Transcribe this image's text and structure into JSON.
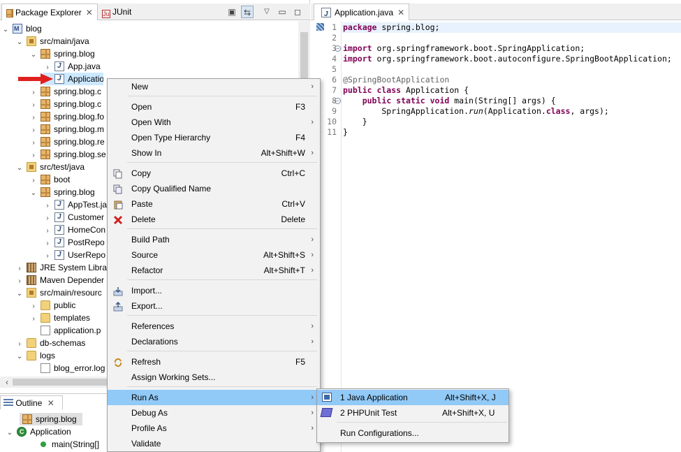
{
  "package_explorer": {
    "tab_label": "Package Explorer",
    "junit_tab_label": "JUnit",
    "close_glyph": "✕"
  },
  "tree": [
    {
      "label": "blog",
      "twisty": "⌄",
      "icon": "project-icon"
    },
    {
      "label": "src/main/java",
      "twisty": "⌄",
      "icon": "source-folder-icon"
    },
    {
      "label": "spring.blog",
      "twisty": "⌄",
      "icon": "package-icon"
    },
    {
      "label": "App.java",
      "twisty": "›",
      "icon": "java-file-icon"
    },
    {
      "label": "Application.java",
      "twisty": "›",
      "icon": "java-file-icon"
    },
    {
      "label": "spring.blog.c",
      "twisty": "›",
      "icon": "package-icon"
    },
    {
      "label": "spring.blog.c",
      "twisty": "›",
      "icon": "package-icon"
    },
    {
      "label": "spring.blog.fo",
      "twisty": "›",
      "icon": "package-icon"
    },
    {
      "label": "spring.blog.m",
      "twisty": "›",
      "icon": "package-icon"
    },
    {
      "label": "spring.blog.re",
      "twisty": "›",
      "icon": "package-icon"
    },
    {
      "label": "spring.blog.se",
      "twisty": "›",
      "icon": "package-icon"
    },
    {
      "label": "src/test/java",
      "twisty": "⌄",
      "icon": "source-folder-icon"
    },
    {
      "label": "boot",
      "twisty": "›",
      "icon": "package-icon"
    },
    {
      "label": "spring.blog",
      "twisty": "⌄",
      "icon": "package-icon"
    },
    {
      "label": "AppTest.ja",
      "twisty": "›",
      "icon": "java-file-icon"
    },
    {
      "label": "Customer",
      "twisty": "›",
      "icon": "java-file-icon"
    },
    {
      "label": "HomeCon",
      "twisty": "›",
      "icon": "java-file-icon"
    },
    {
      "label": "PostRepo",
      "twisty": "›",
      "icon": "java-file-icon"
    },
    {
      "label": "UserRepo",
      "twisty": "›",
      "icon": "java-file-icon"
    },
    {
      "label": "JRE System Librar",
      "twisty": "›",
      "icon": "library-icon"
    },
    {
      "label": "Maven Depender",
      "twisty": "›",
      "icon": "library-icon"
    },
    {
      "label": "src/main/resourc",
      "twisty": "⌄",
      "icon": "source-folder-icon"
    },
    {
      "label": "public",
      "twisty": "›",
      "icon": "folder-icon"
    },
    {
      "label": "templates",
      "twisty": "›",
      "icon": "folder-icon"
    },
    {
      "label": "application.p",
      "twisty": "",
      "icon": "file-icon"
    },
    {
      "label": "db-schemas",
      "twisty": "›",
      "icon": "folder-icon"
    },
    {
      "label": "logs",
      "twisty": "⌄",
      "icon": "folder-icon"
    },
    {
      "label": "blog_error.log",
      "twisty": "",
      "icon": "file-icon"
    }
  ],
  "outline": {
    "tab_label": "Outline",
    "items": [
      {
        "label": "spring.blog"
      },
      {
        "label": "Application"
      },
      {
        "label": "main(String[]"
      }
    ]
  },
  "editor": {
    "tab_label": "Application.java",
    "lines": [
      {
        "n": "1",
        "parts": [
          {
            "t": "package",
            "c": "kw"
          },
          {
            "t": " spring.blog;",
            "c": ""
          }
        ]
      },
      {
        "n": "2",
        "parts": []
      },
      {
        "n": "3",
        "parts": [
          {
            "t": "import",
            "c": "kw"
          },
          {
            "t": " org.springframework.boot.SpringApplication;",
            "c": ""
          }
        ]
      },
      {
        "n": "4",
        "parts": [
          {
            "t": "import",
            "c": "kw"
          },
          {
            "t": " org.springframework.boot.autoconfigure.SpringBootApplication;",
            "c": ""
          }
        ]
      },
      {
        "n": "5",
        "parts": []
      },
      {
        "n": "6",
        "parts": [
          {
            "t": "@SpringBootApplication",
            "c": "ann"
          }
        ]
      },
      {
        "n": "7",
        "parts": [
          {
            "t": "public class",
            "c": "kw"
          },
          {
            "t": " Application {",
            "c": ""
          }
        ]
      },
      {
        "n": "8",
        "parts": [
          {
            "t": "    ",
            "c": ""
          },
          {
            "t": "public static void",
            "c": "kw"
          },
          {
            "t": " main(String[] args) {",
            "c": ""
          }
        ]
      },
      {
        "n": "9",
        "parts": [
          {
            "t": "        SpringApplication.",
            "c": ""
          },
          {
            "t": "run",
            "c": "it"
          },
          {
            "t": "(Application.",
            "c": ""
          },
          {
            "t": "class",
            "c": "kw"
          },
          {
            "t": ", args);",
            "c": ""
          }
        ]
      },
      {
        "n": "10",
        "parts": [
          {
            "t": "    }",
            "c": ""
          }
        ]
      },
      {
        "n": "11",
        "parts": [
          {
            "t": "}",
            "c": ""
          }
        ]
      }
    ]
  },
  "context_menu": {
    "items": [
      {
        "label": "New",
        "accel": "",
        "submenu": true,
        "icon": ""
      },
      {
        "label": "Open",
        "accel": "F3",
        "submenu": false,
        "icon": ""
      },
      {
        "label": "Open With",
        "accel": "",
        "submenu": true,
        "icon": ""
      },
      {
        "label": "Open Type Hierarchy",
        "accel": "F4",
        "submenu": false,
        "icon": ""
      },
      {
        "label": "Show In",
        "accel": "Alt+Shift+W",
        "submenu": true,
        "icon": ""
      },
      {
        "label": "Copy",
        "accel": "Ctrl+C",
        "submenu": false,
        "icon": "copy-icon"
      },
      {
        "label": "Copy Qualified Name",
        "accel": "",
        "submenu": false,
        "icon": "copy-qualified-icon"
      },
      {
        "label": "Paste",
        "accel": "Ctrl+V",
        "submenu": false,
        "icon": "paste-icon"
      },
      {
        "label": "Delete",
        "accel": "Delete",
        "submenu": false,
        "icon": "delete-icon"
      },
      {
        "label": "Build Path",
        "accel": "",
        "submenu": true,
        "icon": ""
      },
      {
        "label": "Source",
        "accel": "Alt+Shift+S",
        "submenu": true,
        "icon": ""
      },
      {
        "label": "Refactor",
        "accel": "Alt+Shift+T",
        "submenu": true,
        "icon": ""
      },
      {
        "label": "Import...",
        "accel": "",
        "submenu": false,
        "icon": "import-icon"
      },
      {
        "label": "Export...",
        "accel": "",
        "submenu": false,
        "icon": "export-icon"
      },
      {
        "label": "References",
        "accel": "",
        "submenu": true,
        "icon": ""
      },
      {
        "label": "Declarations",
        "accel": "",
        "submenu": true,
        "icon": ""
      },
      {
        "label": "Refresh",
        "accel": "F5",
        "submenu": false,
        "icon": "refresh-icon"
      },
      {
        "label": "Assign Working Sets...",
        "accel": "",
        "submenu": false,
        "icon": ""
      },
      {
        "label": "Run As",
        "accel": "",
        "submenu": true,
        "icon": ""
      },
      {
        "label": "Debug As",
        "accel": "",
        "submenu": true,
        "icon": ""
      },
      {
        "label": "Profile As",
        "accel": "",
        "submenu": true,
        "icon": ""
      },
      {
        "label": "Validate",
        "accel": "",
        "submenu": false,
        "icon": ""
      }
    ],
    "submenu_glyph": "›"
  },
  "run_as_submenu": {
    "items": [
      {
        "label": "1 Java Application",
        "accel": "Alt+Shift+X, J"
      },
      {
        "label": "2 PHPUnit Test",
        "accel": "Alt+Shift+X, U"
      },
      {
        "label": "Run Configurations...",
        "accel": ""
      }
    ]
  },
  "colors": {
    "highlight": "#91c9f7",
    "keyword": "#7f0055",
    "arrow": "#e02020"
  }
}
